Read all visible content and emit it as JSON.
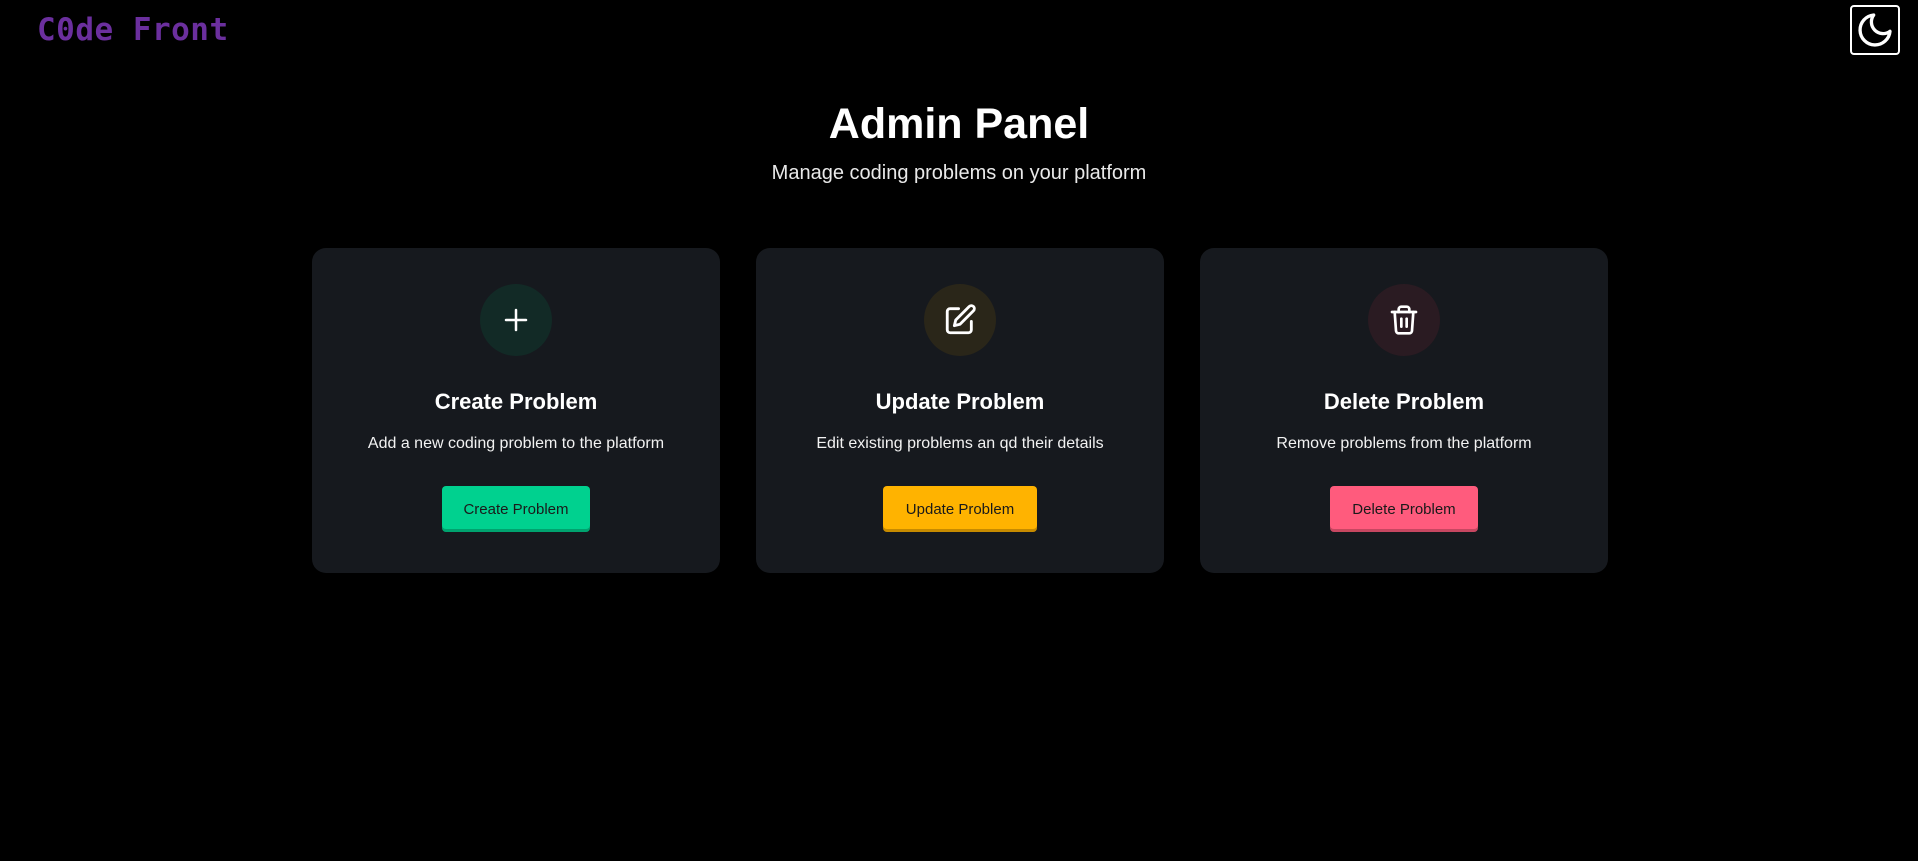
{
  "app": {
    "logo_text": "C0de Front",
    "logo_color": "#6b2f9e"
  },
  "theme_toggle": {
    "icon": "moon-icon"
  },
  "header": {
    "title": "Admin Panel",
    "subtitle": "Manage coding problems on your platform"
  },
  "cards": [
    {
      "icon": "plus-icon",
      "accent": "#00d18f",
      "title": "Create Problem",
      "description": "Add a new coding problem to the platform",
      "button_label": "Create Problem"
    },
    {
      "icon": "edit-icon",
      "accent": "#ffb300",
      "title": "Update Problem",
      "description": "Edit existing problems an qd their details",
      "button_label": "Update Problem"
    },
    {
      "icon": "trash-icon",
      "accent": "#ff5b7d",
      "title": "Delete Problem",
      "description": "Remove problems from the platform",
      "button_label": "Delete Problem"
    }
  ]
}
